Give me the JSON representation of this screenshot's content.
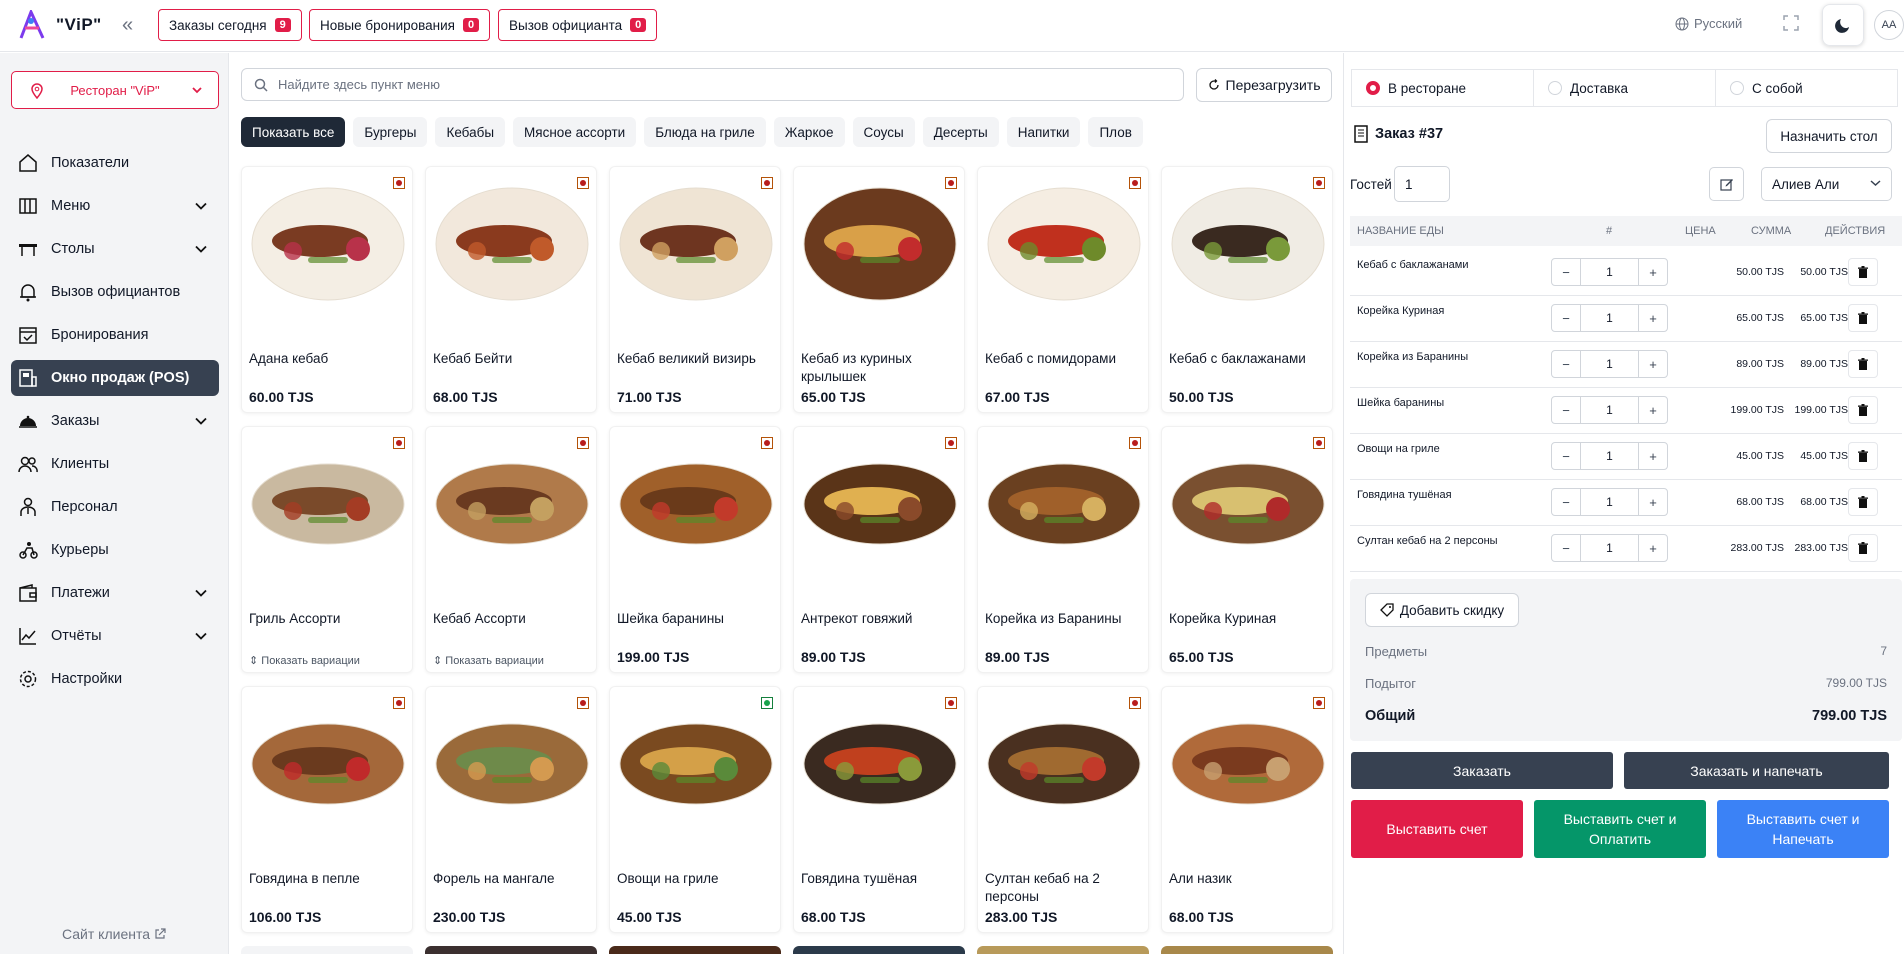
{
  "header": {
    "app_name": "\"ViP\"",
    "orders_today_label": "Заказы сегодня",
    "orders_today_count": "9",
    "new_bookings_label": "Новые бронирования",
    "new_bookings_count": "0",
    "waiter_call_label": "Вызов официанта",
    "waiter_call_count": "0",
    "language": "Русский",
    "avatar": "AA",
    "accent_color": "#e11d48"
  },
  "sidebar": {
    "restaurant": "Ресторан \"ViP\"",
    "items": [
      {
        "label": "Показатели",
        "icon": "home-icon"
      },
      {
        "label": "Меню",
        "icon": "menu-book-icon"
      },
      {
        "label": "Столы",
        "icon": "table-icon"
      },
      {
        "label": "Вызов официантов",
        "icon": "bell-icon"
      },
      {
        "label": "Бронирования",
        "icon": "calendar-check-icon"
      },
      {
        "label": "Окно продаж (POS)",
        "icon": "pos-icon"
      },
      {
        "label": "Заказы",
        "icon": "cloche-icon"
      },
      {
        "label": "Клиенты",
        "icon": "users-icon"
      },
      {
        "label": "Персонал",
        "icon": "staff-icon"
      },
      {
        "label": "Курьеры",
        "icon": "courier-icon"
      },
      {
        "label": "Платежи",
        "icon": "wallet-icon"
      },
      {
        "label": "Отчёты",
        "icon": "chart-line-icon"
      },
      {
        "label": "Настройки",
        "icon": "gear-icon"
      }
    ],
    "client_site": "Сайт клиента"
  },
  "menu": {
    "search_placeholder": "Найдите здесь пункт меню",
    "reload_label": "Перезагрузить",
    "categories": [
      "Показать все",
      "Бургеры",
      "Кебабы",
      "Мясное ассорти",
      "Блюда на гриле",
      "Жаркое",
      "Соусы",
      "Десерты",
      "Напитки",
      "Плов"
    ],
    "variations_label": "Показать вариации",
    "items": [
      {
        "name": "Адана кебаб",
        "price": "60.00 TJS"
      },
      {
        "name": "Кебаб Бейти",
        "price": "68.00 TJS"
      },
      {
        "name": "Кебаб великий визирь",
        "price": "71.00 TJS"
      },
      {
        "name": "Кебаб из куриных крылышек",
        "price": "65.00 TJS"
      },
      {
        "name": "Кебаб с помидорами",
        "price": "67.00 TJS"
      },
      {
        "name": "Кебаб с баклажанами",
        "price": "50.00 TJS"
      },
      {
        "name": "Гриль Ассорти",
        "price": ""
      },
      {
        "name": "Кебаб Ассорти",
        "price": ""
      },
      {
        "name": "Шейка баранины",
        "price": "199.00 TJS"
      },
      {
        "name": "Антрекот говяжий",
        "price": "89.00 TJS"
      },
      {
        "name": "Корейка из Баранины",
        "price": "89.00 TJS"
      },
      {
        "name": "Корейка Куриная",
        "price": "65.00 TJS"
      },
      {
        "name": "Говядина в пепле",
        "price": "106.00 TJS"
      },
      {
        "name": "Форель на мангале",
        "price": "230.00 TJS"
      },
      {
        "name": "Овощи на гриле",
        "price": "45.00 TJS"
      },
      {
        "name": "Говядина тушёная",
        "price": "68.00 TJS"
      },
      {
        "name": "Султан кебаб на 2 персоны",
        "price": "283.00 TJS"
      },
      {
        "name": "Али назик",
        "price": "68.00 TJS"
      }
    ]
  },
  "order": {
    "types": [
      "В ресторане",
      "Доставка",
      "С собой"
    ],
    "title": "Заказ #37",
    "assign_table": "Назначить стол",
    "guests_label": "Гостей",
    "guests_value": "1",
    "waiter": "Алиев Али",
    "columns": [
      "НАЗВАНИЕ ЕДЫ",
      "#",
      "ЦЕНА",
      "СУММА",
      "ДЕЙСТВИЯ"
    ],
    "rows": [
      {
        "name": "Кебаб с баклажанами",
        "qty": "1",
        "price": "50.00 TJS",
        "sum": "50.00 TJS"
      },
      {
        "name": "Корейка Куриная",
        "qty": "1",
        "price": "65.00 TJS",
        "sum": "65.00 TJS"
      },
      {
        "name": "Корейка из Баранины",
        "qty": "1",
        "price": "89.00 TJS",
        "sum": "89.00 TJS"
      },
      {
        "name": "Шейка баранины",
        "qty": "1",
        "price": "199.00 TJS",
        "sum": "199.00 TJS"
      },
      {
        "name": "Овощи на гриле",
        "qty": "1",
        "price": "45.00 TJS",
        "sum": "45.00 TJS"
      },
      {
        "name": "Говядина тушёная",
        "qty": "1",
        "price": "68.00 TJS",
        "sum": "68.00 TJS"
      },
      {
        "name": "Султан кебаб на 2 персоны",
        "qty": "1",
        "price": "283.00 TJS",
        "sum": "283.00 TJS"
      }
    ],
    "add_discount": "Добавить скидку",
    "items_label": "Предметы",
    "items_value": "7",
    "subtotal_label": "Подытог",
    "subtotal_value": "799.00 TJS",
    "total_label": "Общий",
    "total_value": "799.00 TJS",
    "btn_order": "Заказать",
    "btn_order_print": "Заказать и напечать",
    "btn_bill": "Выставить счет",
    "btn_bill_pay": "Выставить счет и Оплатить",
    "btn_bill_print": "Выставить счет и Напечать"
  }
}
